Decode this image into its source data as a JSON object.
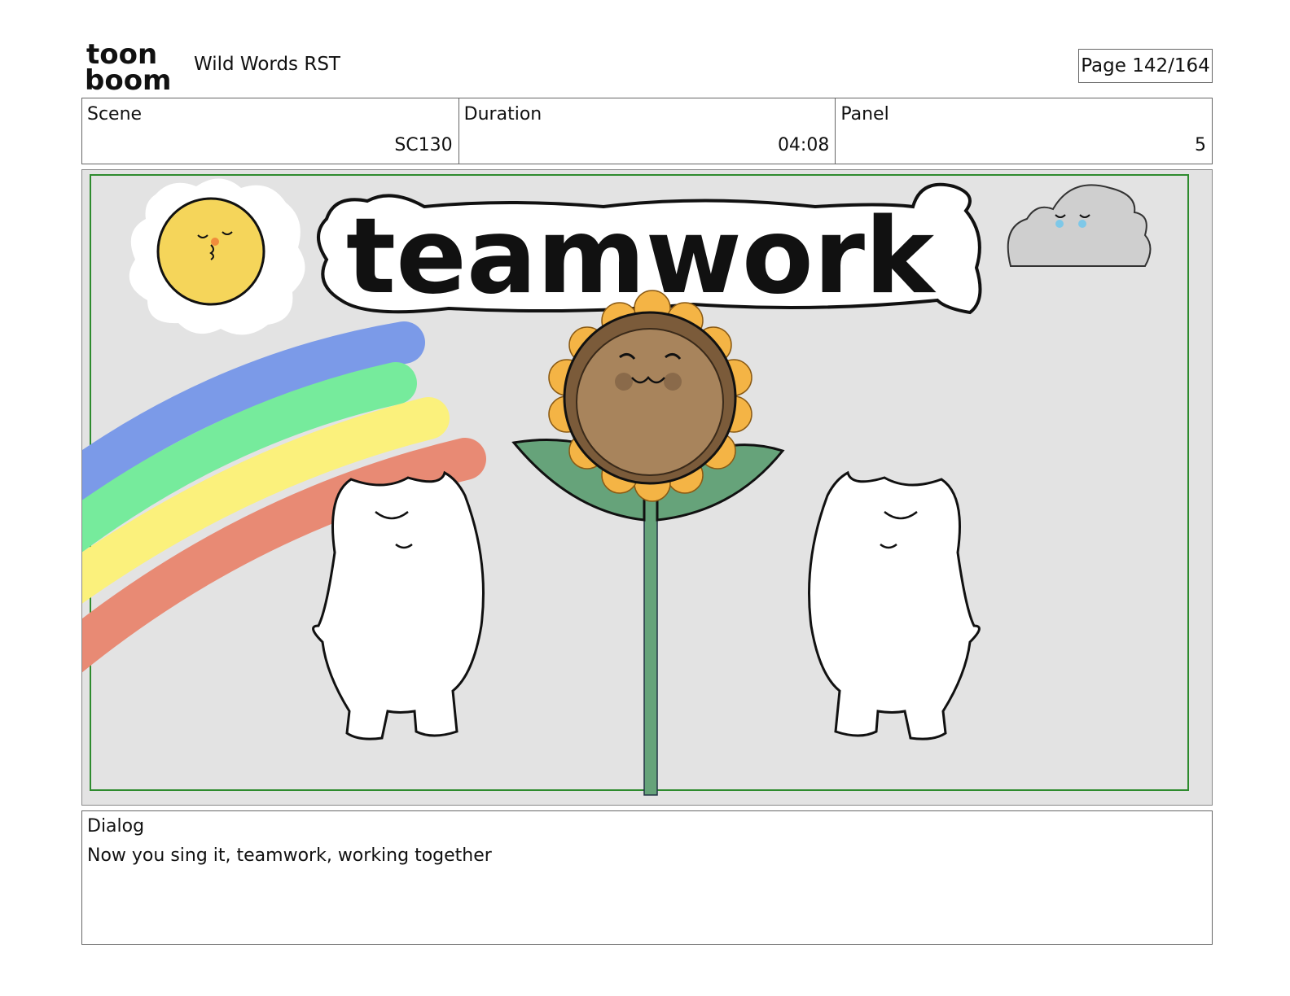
{
  "header": {
    "logo_text_top": "toon",
    "logo_text_bottom": "boom",
    "project_title": "Wild Words RST",
    "page_indicator": "Page 142/164"
  },
  "info": {
    "scene_label": "Scene",
    "scene_value": "SC130",
    "duration_label": "Duration",
    "duration_value": "04:08",
    "panel_label": "Panel",
    "panel_value": "5"
  },
  "artwork": {
    "title_word": "teamwork",
    "colors": {
      "background": "#e3e3e3",
      "safe_frame": "#2e8b2e",
      "sun": "#f5d55a",
      "rainbow_blue": "#7b9ae8",
      "rainbow_green": "#76eb9c",
      "rainbow_yellow": "#fbf17c",
      "rainbow_red": "#e88a74",
      "petals": "#f4b445",
      "flower_center": "#a8845c",
      "flower_ring": "#7b5b3a",
      "leaves": "#66a37a",
      "cloud": "#cfcfcf"
    }
  },
  "dialog": {
    "label": "Dialog",
    "text": "Now you sing it, teamwork, working together"
  }
}
